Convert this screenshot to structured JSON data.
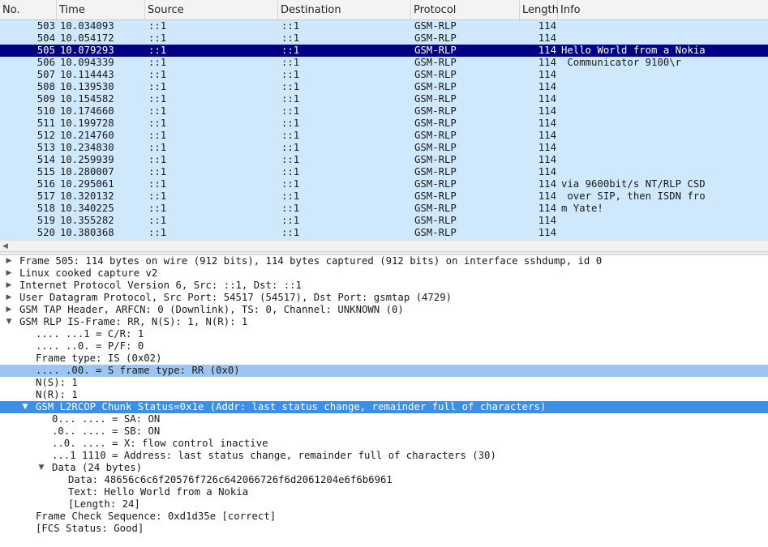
{
  "columns": {
    "no": "No.",
    "time": "Time",
    "source": "Source",
    "destination": "Destination",
    "protocol": "Protocol",
    "length": "Length",
    "info": "Info"
  },
  "packets": [
    {
      "no": "503",
      "time": "10.034093",
      "src": "::1",
      "dst": "::1",
      "proto": "GSM-RLP",
      "len": "114",
      "info": ""
    },
    {
      "no": "504",
      "time": "10.054172",
      "src": "::1",
      "dst": "::1",
      "proto": "GSM-RLP",
      "len": "114",
      "info": ""
    },
    {
      "no": "505",
      "time": "10.079293",
      "src": "::1",
      "dst": "::1",
      "proto": "GSM-RLP",
      "len": "114",
      "info": "Hello World from a Nokia"
    },
    {
      "no": "506",
      "time": "10.094339",
      "src": "::1",
      "dst": "::1",
      "proto": "GSM-RLP",
      "len": "114",
      "info": " Communicator 9100\\r"
    },
    {
      "no": "507",
      "time": "10.114443",
      "src": "::1",
      "dst": "::1",
      "proto": "GSM-RLP",
      "len": "114",
      "info": ""
    },
    {
      "no": "508",
      "time": "10.139530",
      "src": "::1",
      "dst": "::1",
      "proto": "GSM-RLP",
      "len": "114",
      "info": ""
    },
    {
      "no": "509",
      "time": "10.154582",
      "src": "::1",
      "dst": "::1",
      "proto": "GSM-RLP",
      "len": "114",
      "info": ""
    },
    {
      "no": "510",
      "time": "10.174660",
      "src": "::1",
      "dst": "::1",
      "proto": "GSM-RLP",
      "len": "114",
      "info": ""
    },
    {
      "no": "511",
      "time": "10.199728",
      "src": "::1",
      "dst": "::1",
      "proto": "GSM-RLP",
      "len": "114",
      "info": ""
    },
    {
      "no": "512",
      "time": "10.214760",
      "src": "::1",
      "dst": "::1",
      "proto": "GSM-RLP",
      "len": "114",
      "info": ""
    },
    {
      "no": "513",
      "time": "10.234830",
      "src": "::1",
      "dst": "::1",
      "proto": "GSM-RLP",
      "len": "114",
      "info": ""
    },
    {
      "no": "514",
      "time": "10.259939",
      "src": "::1",
      "dst": "::1",
      "proto": "GSM-RLP",
      "len": "114",
      "info": ""
    },
    {
      "no": "515",
      "time": "10.280007",
      "src": "::1",
      "dst": "::1",
      "proto": "GSM-RLP",
      "len": "114",
      "info": ""
    },
    {
      "no": "516",
      "time": "10.295061",
      "src": "::1",
      "dst": "::1",
      "proto": "GSM-RLP",
      "len": "114",
      "info": "via 9600bit/s NT/RLP CSD"
    },
    {
      "no": "517",
      "time": "10.320132",
      "src": "::1",
      "dst": "::1",
      "proto": "GSM-RLP",
      "len": "114",
      "info": " over SIP, then ISDN fro"
    },
    {
      "no": "518",
      "time": "10.340225",
      "src": "::1",
      "dst": "::1",
      "proto": "GSM-RLP",
      "len": "114",
      "info": "m Yate!"
    },
    {
      "no": "519",
      "time": "10.355282",
      "src": "::1",
      "dst": "::1",
      "proto": "GSM-RLP",
      "len": "114",
      "info": ""
    },
    {
      "no": "520",
      "time": "10.380368",
      "src": "::1",
      "dst": "::1",
      "proto": "GSM-RLP",
      "len": "114",
      "info": ""
    }
  ],
  "selected_packet": "505",
  "detail_tree": [
    {
      "text": "Frame 505: 114 bytes on wire (912 bits), 114 bytes captured (912 bits) on interface sshdump, id 0",
      "level": 0,
      "expander": "collapsed",
      "state": ""
    },
    {
      "text": "Linux cooked capture v2",
      "level": 0,
      "expander": "collapsed",
      "state": ""
    },
    {
      "text": "Internet Protocol Version 6, Src: ::1, Dst: ::1",
      "level": 0,
      "expander": "collapsed",
      "state": ""
    },
    {
      "text": "User Datagram Protocol, Src Port: 54517 (54517), Dst Port: gsmtap (4729)",
      "level": 0,
      "expander": "collapsed",
      "state": ""
    },
    {
      "text": "GSM TAP Header, ARFCN: 0 (Downlink), TS: 0, Channel: UNKNOWN (0)",
      "level": 0,
      "expander": "collapsed",
      "state": ""
    },
    {
      "text": "GSM RLP IS-Frame: RR, N(S): 1, N(R): 1",
      "level": 0,
      "expander": "expanded",
      "state": ""
    },
    {
      "text": ".... ...1 = C/R: 1",
      "level": 1,
      "expander": "none",
      "state": ""
    },
    {
      "text": ".... ..0. = P/F: 0",
      "level": 1,
      "expander": "none",
      "state": ""
    },
    {
      "text": "Frame type: IS (0x02)",
      "level": 1,
      "expander": "none",
      "state": ""
    },
    {
      "text": ".... .00. = S frame type: RR (0x0)",
      "level": 1,
      "expander": "none",
      "state": "highlight"
    },
    {
      "text": "N(S): 1",
      "level": 1,
      "expander": "none",
      "state": ""
    },
    {
      "text": "N(R): 1",
      "level": 1,
      "expander": "none",
      "state": ""
    },
    {
      "text": "GSM L2RCOP Chunk Status=0x1e (Addr: last status change, remainder full of characters)",
      "level": 1,
      "expander": "expanded",
      "state": "selected"
    },
    {
      "text": "0... .... = SA: ON",
      "level": 2,
      "expander": "none",
      "state": ""
    },
    {
      "text": ".0.. .... = SB: ON",
      "level": 2,
      "expander": "none",
      "state": ""
    },
    {
      "text": "..0. .... = X: flow control inactive",
      "level": 2,
      "expander": "none",
      "state": ""
    },
    {
      "text": "...1 1110 = Address: last status change, remainder full of characters (30)",
      "level": 2,
      "expander": "none",
      "state": ""
    },
    {
      "text": "Data (24 bytes)",
      "level": 2,
      "expander": "expanded",
      "state": ""
    },
    {
      "text": "Data: 48656c6c6f20576f726c642066726f6d2061204e6f6b6961",
      "level": 3,
      "expander": "none",
      "state": ""
    },
    {
      "text": "Text: Hello World from a Nokia",
      "level": 3,
      "expander": "none",
      "state": ""
    },
    {
      "text": "[Length: 24]",
      "level": 3,
      "expander": "none",
      "state": ""
    },
    {
      "text": "Frame Check Sequence: 0xd1d35e [correct]",
      "level": 1,
      "expander": "none",
      "state": ""
    },
    {
      "text": "[FCS Status: Good]",
      "level": 1,
      "expander": "none",
      "state": ""
    }
  ],
  "icons": {
    "collapsed": "▶",
    "expanded": "▼",
    "scroll_left": "◀"
  },
  "colors": {
    "list_background": "#cfe8fc",
    "selected_row": "#000080",
    "selected_tree_item": "#3d8fe3",
    "highlighted_field": "#9cc6f1"
  }
}
